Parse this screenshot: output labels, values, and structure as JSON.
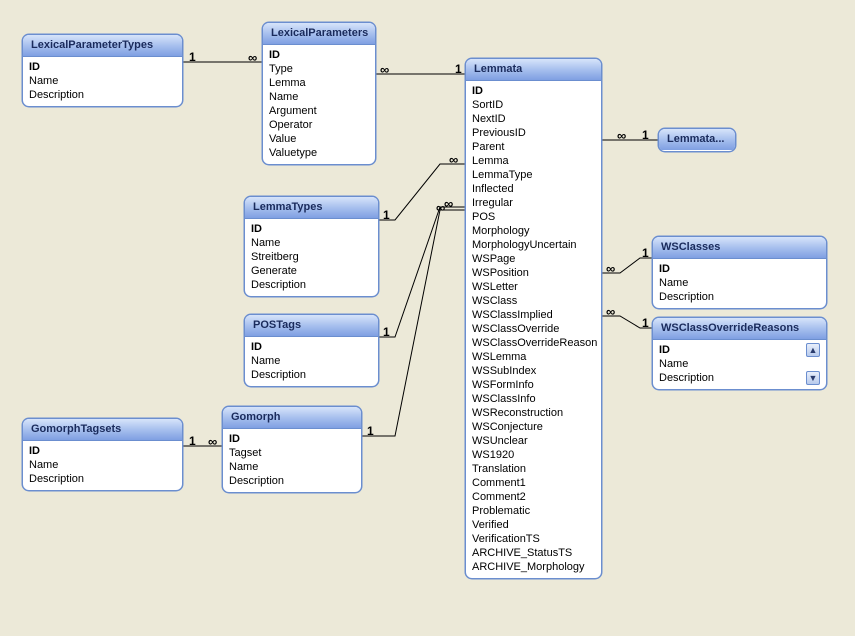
{
  "tables": {
    "lexicalParameterTypes": {
      "title": "LexicalParameterTypes",
      "fields": [
        "ID",
        "Name",
        "Description"
      ]
    },
    "lexicalParameters": {
      "title": "LexicalParameters",
      "fields": [
        "ID",
        "Type",
        "Lemma",
        "Name",
        "Argument",
        "Operator",
        "Value",
        "Valuetype"
      ]
    },
    "lemmaTypes": {
      "title": "LemmaTypes",
      "fields": [
        "ID",
        "Name",
        "Streitberg",
        "Generate",
        "Description"
      ]
    },
    "posTags": {
      "title": "POSTags",
      "fields": [
        "ID",
        "Name",
        "Description"
      ]
    },
    "gomorphTagsets": {
      "title": "GomorphTagsets",
      "fields": [
        "ID",
        "Name",
        "Description"
      ]
    },
    "gomorph": {
      "title": "Gomorph",
      "fields": [
        "ID",
        "Tagset",
        "Name",
        "Description"
      ]
    },
    "lemmata": {
      "title": "Lemmata",
      "fields": [
        "ID",
        "SortID",
        "NextID",
        "PreviousID",
        "Parent",
        "Lemma",
        "LemmaType",
        "Inflected",
        "Irregular",
        "POS",
        "Morphology",
        "MorphologyUncertain",
        "WSPage",
        "WSPosition",
        "WSLetter",
        "WSClass",
        "WSClassImplied",
        "WSClassOverride",
        "WSClassOverrideReason",
        "WSLemma",
        "WSSubIndex",
        "WSFormInfo",
        "WSClassInfo",
        "WSReconstruction",
        "WSConjecture",
        "WSUnclear",
        "WS1920",
        "Translation",
        "Comment1",
        "Comment2",
        "Problematic",
        "Verified",
        "VerificationTS",
        "ARCHIVE_StatusTS",
        "ARCHIVE_Morphology"
      ]
    },
    "lemmataRef": {
      "title": "Lemmata..."
    },
    "wsClasses": {
      "title": "WSClasses",
      "fields": [
        "ID",
        "Name",
        "Description"
      ]
    },
    "wsClassOverrideReasons": {
      "title": "WSClassOverrideReasons",
      "fields": [
        "ID",
        "Name",
        "Description"
      ]
    }
  },
  "relations": [
    {
      "from": "lexicalParameterTypes",
      "to": "lexicalParameters",
      "leftCard": "1",
      "rightCard": "∞"
    },
    {
      "from": "lexicalParameters",
      "to": "lemmata",
      "leftCard": "∞",
      "rightCard": "1"
    },
    {
      "from": "lemmaTypes",
      "to": "lemmata",
      "leftCard": "1",
      "rightCard": "∞"
    },
    {
      "from": "posTags",
      "to": "lemmata",
      "leftCard": "1",
      "rightCard": "∞"
    },
    {
      "from": "gomorphTagsets",
      "to": "gomorph",
      "leftCard": "1",
      "rightCard": "∞"
    },
    {
      "from": "gomorph",
      "to": "lemmata",
      "leftCard": "1",
      "rightCard": "∞"
    },
    {
      "from": "lemmata",
      "to": "lemmataRef",
      "leftCard": "∞",
      "rightCard": "1"
    },
    {
      "from": "lemmata",
      "to": "wsClasses",
      "leftCard": "∞",
      "rightCard": "1"
    },
    {
      "from": "lemmata",
      "to": "wsClassOverrideReasons",
      "leftCard": "∞",
      "rightCard": "1"
    }
  ],
  "cardinality": {
    "one": "1",
    "many": "∞"
  }
}
